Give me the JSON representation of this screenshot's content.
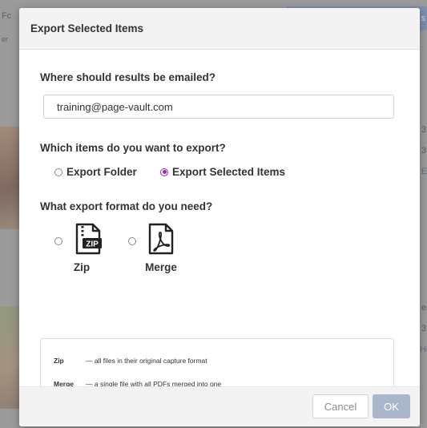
{
  "background": {
    "left_fragment_top": "Fc",
    "left_fragment_second": "er",
    "right_fragment_button": "s",
    "right_fragments": [
      "3",
      "3",
      "EA",
      "er",
      "3",
      "HC"
    ]
  },
  "modal": {
    "title": "Export Selected Items",
    "email": {
      "label": "Where should results be emailed?",
      "value": "training@page-vault.com"
    },
    "items": {
      "label": "Which items do you want to export?",
      "options": [
        {
          "label": "Export Folder",
          "checked": false
        },
        {
          "label": "Export Selected Items",
          "checked": true
        }
      ]
    },
    "format": {
      "label": "What export format do you need?",
      "options": [
        {
          "label": "Zip",
          "icon": "zip-file-icon",
          "icon_text": "ZIP",
          "checked": false
        },
        {
          "label": "Merge",
          "icon": "pdf-file-icon",
          "checked": false
        }
      ]
    },
    "legend": [
      {
        "key": "Zip",
        "desc": "— all files in their original capture format"
      },
      {
        "key": "Merge",
        "desc": "— a single file with all PDFs merged into one"
      }
    ],
    "buttons": {
      "cancel": "Cancel",
      "ok": "OK"
    }
  },
  "colors": {
    "accent": "#9b27b0",
    "ok_button": "#a9b6cc",
    "overlay": "#9b9b9b"
  }
}
